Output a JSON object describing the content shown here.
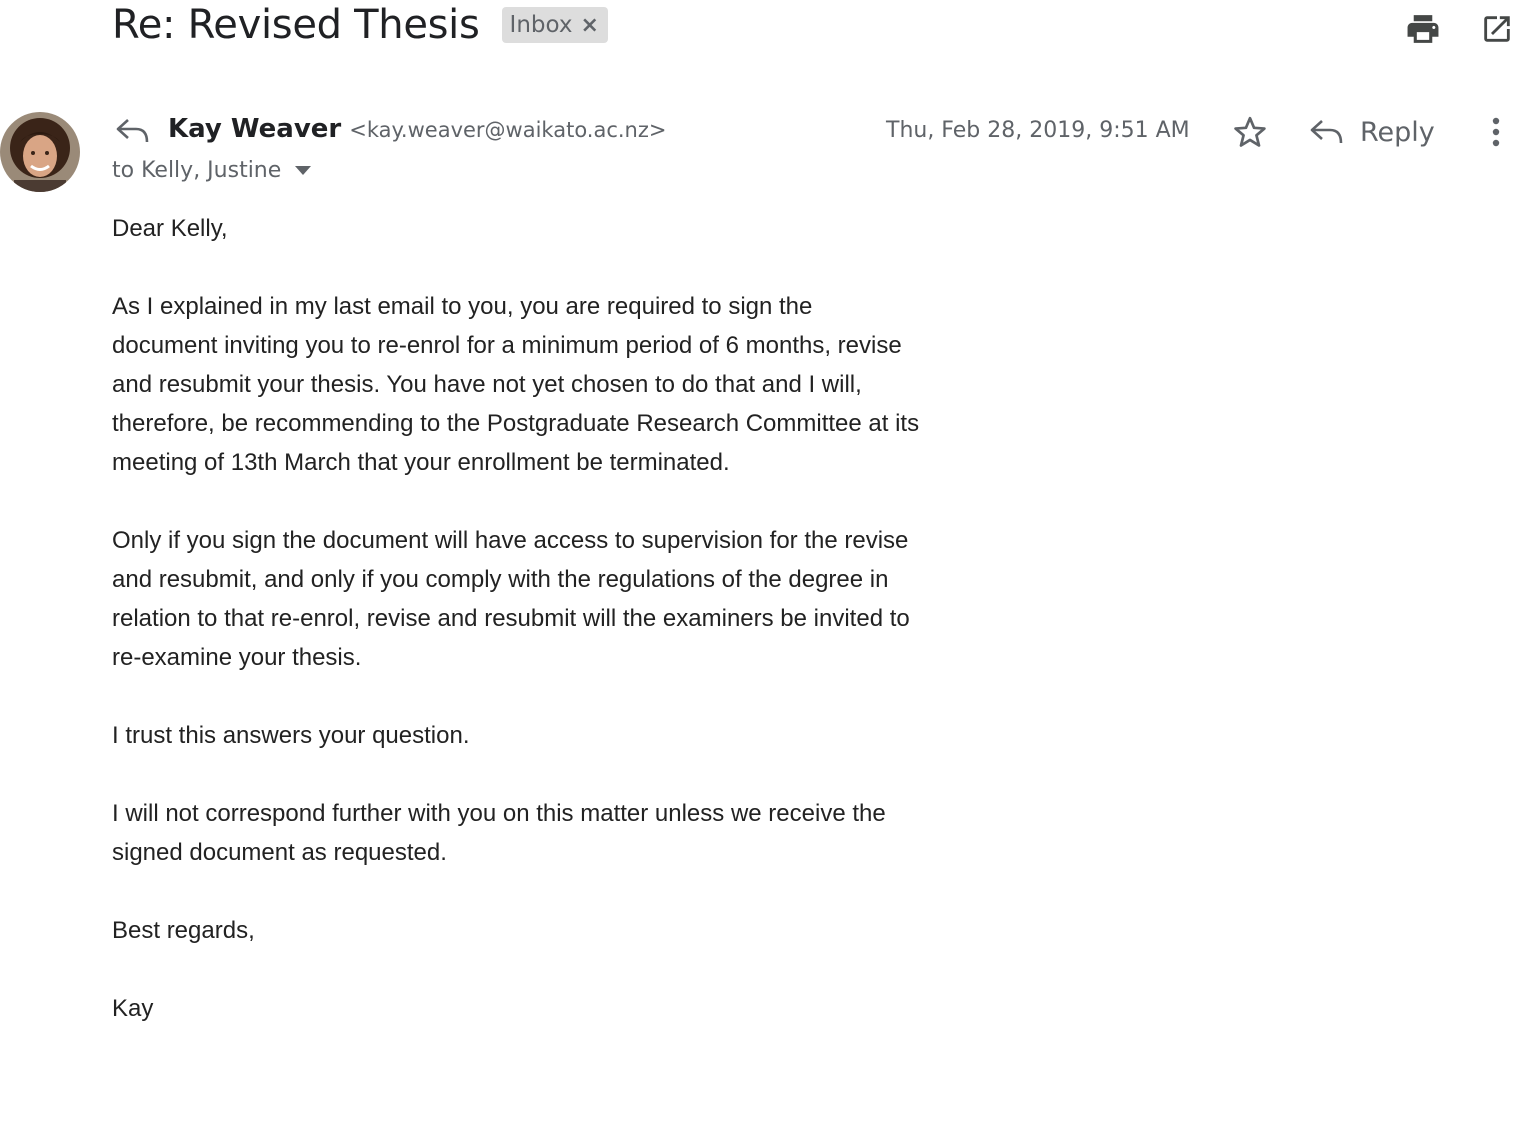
{
  "subject": {
    "title": "Re: Revised Thesis",
    "label": "Inbox",
    "label_remove": "×"
  },
  "toolbar": {
    "print_icon": "print-icon",
    "open_new_window_icon": "open-in-new-window-icon"
  },
  "header": {
    "sender_name": "Kay Weaver",
    "sender_email": "<kay.weaver@waikato.ac.nz>",
    "recipients": "to Kelly, Justine",
    "date": "Thu, Feb 28, 2019, 9:51 AM",
    "reply_label": "Reply"
  },
  "body": {
    "paragraphs": [
      "Dear Kelly,",
      "As I explained in my last email to you, you are required to sign the document inviting you to re-enrol for a minimum period of 6 months, revise and resubmit your thesis. You have not yet chosen to do that and I will, therefore, be recommending to the Postgraduate Research Committee at its meeting of 13th March that your enrollment be terminated.",
      "Only if you sign the document will have access to supervision for the revise and resubmit, and only if you comply with the regulations of the degree in relation to that re-enrol, revise and resubmit will the examiners be invited to re-examine your thesis.",
      "I trust this answers your question.",
      "I will not correspond further with you on this matter unless we receive the signed document as requested.",
      "Best regards,",
      "Kay"
    ]
  },
  "colors": {
    "text": "#202124",
    "secondary": "#5f6368",
    "chip_bg": "#dddddd"
  }
}
